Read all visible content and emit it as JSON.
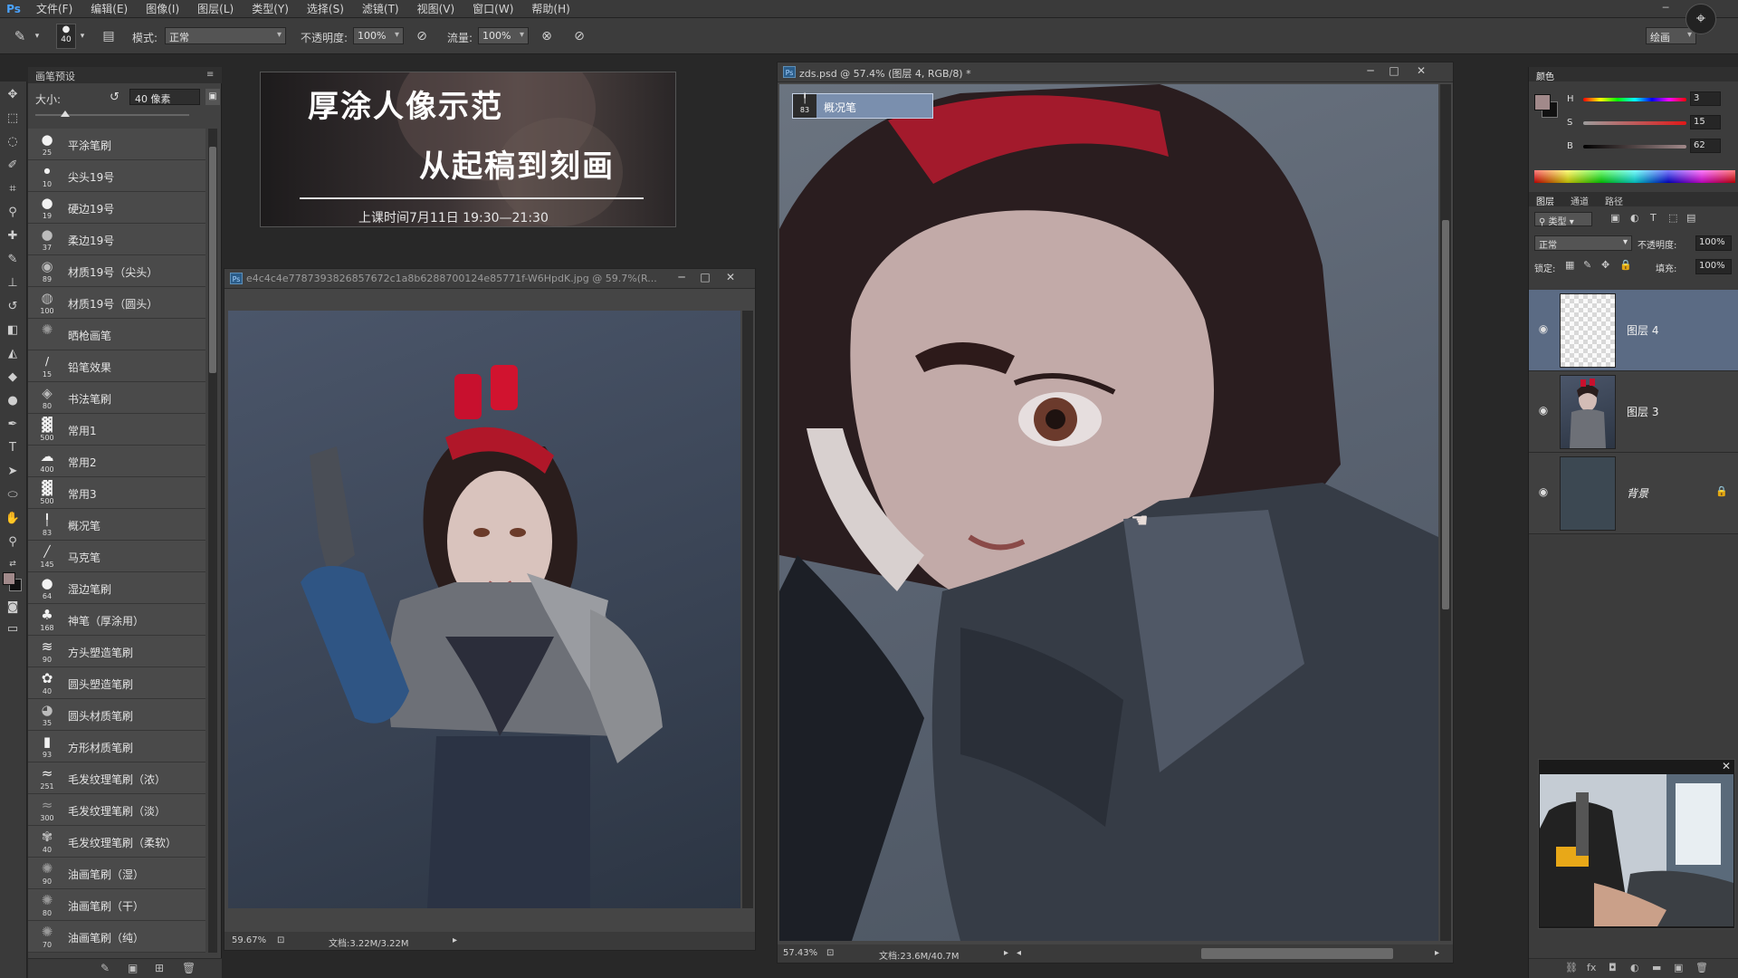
{
  "menu": {
    "logo": "Ps",
    "items": [
      "文件(F)",
      "编辑(E)",
      "图像(I)",
      "图层(L)",
      "类型(Y)",
      "选择(S)",
      "滤镜(T)",
      "视图(V)",
      "窗口(W)",
      "帮助(H)"
    ]
  },
  "options_bar": {
    "brush_size": "40",
    "mode_label": "模式:",
    "mode_value": "正常",
    "opacity_label": "不透明度:",
    "opacity_value": "100%",
    "flow_label": "流量:",
    "flow_value": "100%",
    "workspace": "绘画"
  },
  "brush_panel": {
    "title": "画笔预设",
    "size_label": "大小:",
    "size_value": "40 像素",
    "brushes": [
      {
        "size": "25",
        "name": "平涂笔刷"
      },
      {
        "size": "10",
        "name": "尖头19号"
      },
      {
        "size": "19",
        "name": "硬边19号"
      },
      {
        "size": "37",
        "name": "柔边19号"
      },
      {
        "size": "89",
        "name": "材质19号（尖头）"
      },
      {
        "size": "100",
        "name": "材质19号（圆头）"
      },
      {
        "size": "",
        "name": "晒枪画笔"
      },
      {
        "size": "15",
        "name": "铅笔效果"
      },
      {
        "size": "80",
        "name": "书法笔刷"
      },
      {
        "size": "500",
        "name": "常用1"
      },
      {
        "size": "400",
        "name": "常用2"
      },
      {
        "size": "500",
        "name": "常用3"
      },
      {
        "size": "83",
        "name": "概况笔"
      },
      {
        "size": "145",
        "name": "马克笔"
      },
      {
        "size": "64",
        "name": "湿边笔刷"
      },
      {
        "size": "168",
        "name": "神笔（厚涂用）"
      },
      {
        "size": "90",
        "name": "方头塑造笔刷"
      },
      {
        "size": "40",
        "name": "圆头塑造笔刷"
      },
      {
        "size": "35",
        "name": "圆头材质笔刷"
      },
      {
        "size": "93",
        "name": "方形材质笔刷"
      },
      {
        "size": "251",
        "name": "毛发纹理笔刷（浓）"
      },
      {
        "size": "300",
        "name": "毛发纹理笔刷（淡）"
      },
      {
        "size": "40",
        "name": "毛发纹理笔刷（柔软）"
      },
      {
        "size": "90",
        "name": "油画笔刷（湿）"
      },
      {
        "size": "80",
        "name": "油画笔刷（干）"
      },
      {
        "size": "70",
        "name": "油画笔刷（纯）"
      }
    ]
  },
  "banner": {
    "line1": "厚涂人像示范",
    "line2": "从起稿到刻画",
    "line3": "上课时间7月11日      19:30—21:30"
  },
  "ref_doc": {
    "badge": "Ps",
    "title": "e4c4c4e7787393826857672c1a8b6288700124e85771f-W6HpdK.jpg @ 59.7%(R...",
    "zoom": "59.67%",
    "doc_size": "文档:3.22M/3.22M"
  },
  "main_doc": {
    "badge": "Ps",
    "title": "zds.psd @ 57.4% (图层 4, RGB/8) *",
    "tooltip_size": "83",
    "tooltip_name": "概况笔",
    "zoom": "57.43%",
    "doc_size": "文档:23.6M/40.7M"
  },
  "color_panel": {
    "tab": "颜色",
    "h_label": "H",
    "h_value": "3",
    "s_label": "S",
    "s_value": "15",
    "b_label": "B",
    "b_value": "62",
    "fg_color": "#a1898a",
    "bg_color": "#111111"
  },
  "layers_panel": {
    "tabs": [
      "图层",
      "通道",
      "路径"
    ],
    "filter_label": "类型",
    "blend_mode": "正常",
    "opacity_label": "不透明度:",
    "opacity_value": "100%",
    "lock_label": "锁定:",
    "fill_label": "填充:",
    "fill_value": "100%",
    "layers": [
      {
        "name": "图层 4",
        "active": true
      },
      {
        "name": "图层 3",
        "active": false
      },
      {
        "name": "背景",
        "active": false
      }
    ]
  }
}
